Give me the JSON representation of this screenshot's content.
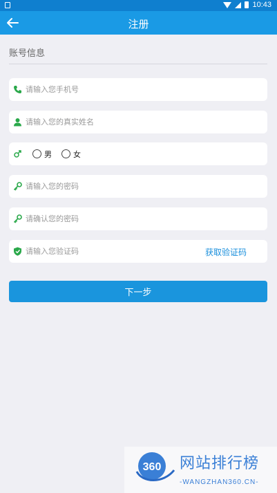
{
  "status_bar": {
    "time": "10:43"
  },
  "header": {
    "title": "注册"
  },
  "section": {
    "title": "账号信息"
  },
  "form": {
    "phone": {
      "placeholder": "请输入您手机号",
      "icon": "phone-icon"
    },
    "name": {
      "placeholder": "请输入您的真实姓名",
      "icon": "person-icon"
    },
    "gender": {
      "icon": "gender-icon",
      "options": [
        {
          "label": "男"
        },
        {
          "label": "女"
        }
      ]
    },
    "password": {
      "placeholder": "请输入您的密码",
      "icon": "key-icon"
    },
    "confirm": {
      "placeholder": "请确认您的密码",
      "icon": "key-icon"
    },
    "code": {
      "placeholder": "请输入您验证码",
      "icon": "shield-icon",
      "link": "获取验证码"
    }
  },
  "next_button": {
    "label": "下一步"
  },
  "watermark": {
    "logo": "360",
    "title": "网站排行榜",
    "subtitle": "-WANGZHAN360.CN-"
  },
  "colors": {
    "primary": "#1a9ae5",
    "status_bar": "#0f7fcf",
    "icon_green": "#2aa84a",
    "background": "#efeff4"
  }
}
